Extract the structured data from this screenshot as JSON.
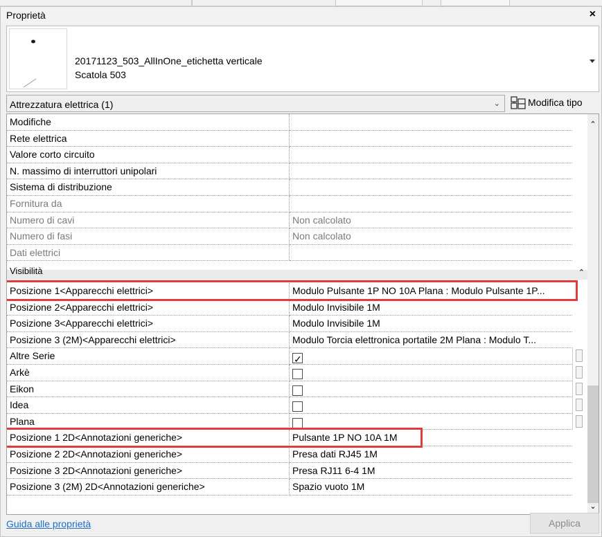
{
  "panel": {
    "title": "Proprietà",
    "close_glyph": "×"
  },
  "type_selector": {
    "family_type": "20171123_503_AllInOne_etichetta verticale",
    "subtitle": "Scatola 503",
    "dropdown_icon": "caret-down-icon"
  },
  "filter": {
    "label": "Attrezzatura elettrica (1)",
    "chevron": "⌄",
    "edit_type_label": "Modifica tipo",
    "edit_type_icon": "edit-type-icon"
  },
  "rows_top": [
    {
      "name": "Modifiche",
      "value": "",
      "readonly": false
    },
    {
      "name": "Rete elettrica",
      "value": "",
      "readonly": false
    },
    {
      "name": "Valore corto circuito",
      "value": "",
      "readonly": false
    },
    {
      "name": "N. massimo di interruttori unipolari",
      "value": "",
      "readonly": false
    },
    {
      "name": "Sistema di distribuzione",
      "value": "",
      "readonly": false
    },
    {
      "name": "Fornitura da",
      "value": "",
      "readonly": true
    },
    {
      "name": "Numero di cavi",
      "value": "Non calcolato",
      "readonly": true
    },
    {
      "name": "Numero di fasi",
      "value": "Non calcolato",
      "readonly": true
    },
    {
      "name": "Dati elettrici",
      "value": "",
      "readonly": true
    }
  ],
  "group_visibility": {
    "label": "Visibilità",
    "toggle": "⌃"
  },
  "rows_visibility": [
    {
      "name": "Posizione 1<Apparecchi elettrici>",
      "value": "Modulo Pulsante 1P NO 10A Plana : Modulo Pulsante 1P..."
    },
    {
      "name": "Posizione 2<Apparecchi elettrici>",
      "value": "Modulo Invisibile 1M"
    },
    {
      "name": "Posizione 3<Apparecchi elettrici>",
      "value": "Modulo Invisibile 1M"
    },
    {
      "name": "Posizione 3 (2M)<Apparecchi elettrici>",
      "value": "Modulo Torcia elettronica portatile 2M Plana : Modulo T..."
    }
  ],
  "rows_series": [
    {
      "name": "Altre Serie",
      "checked": true
    },
    {
      "name": "Arkè",
      "checked": false
    },
    {
      "name": "Eikon",
      "checked": false
    },
    {
      "name": "Idea",
      "checked": false
    },
    {
      "name": "Plana",
      "checked": false
    }
  ],
  "rows_annotations": [
    {
      "name": "Posizione 1 2D<Annotazioni generiche>",
      "value": "Pulsante 1P NO 10A 1M"
    },
    {
      "name": "Posizione 2 2D<Annotazioni generiche>",
      "value": "Presa dati RJ45 1M"
    },
    {
      "name": "Posizione 3 2D<Annotazioni generiche>",
      "value": "Presa RJ11 6-4 1M"
    },
    {
      "name": "Posizione 3 (2M) 2D<Annotazioni generiche>",
      "value": "Spazio vuoto 1M"
    }
  ],
  "scrollbar": {
    "up": "⌃",
    "down": "⌄"
  },
  "footer": {
    "help_link": "Guida alle proprietà",
    "apply_label": "Applica"
  },
  "colors": {
    "highlight": "#e03c3c",
    "link": "#1e6ec8"
  }
}
